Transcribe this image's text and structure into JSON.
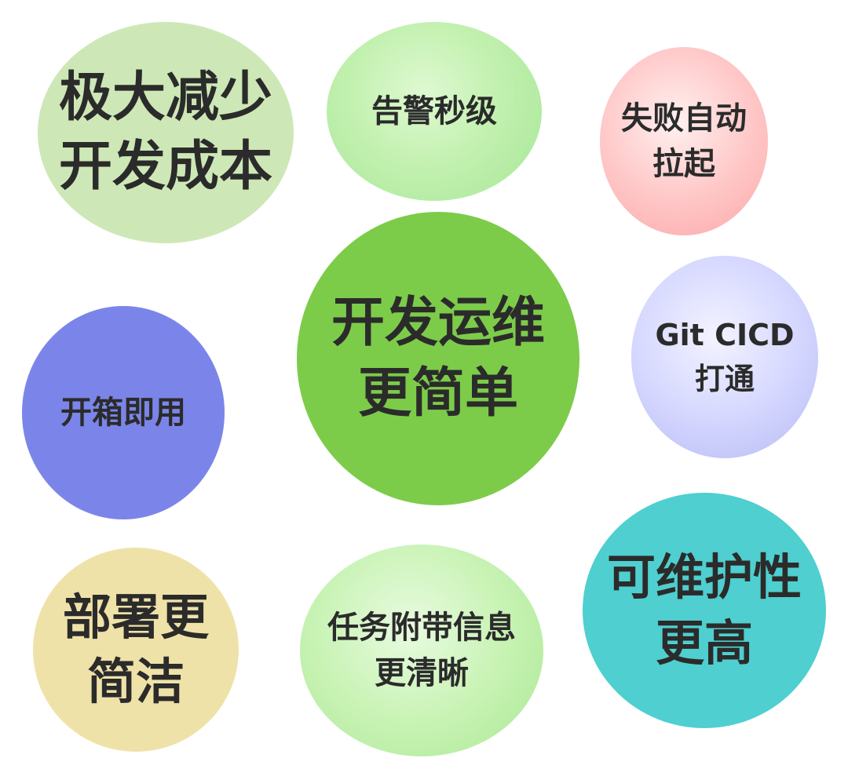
{
  "bubbles": {
    "cost": {
      "line1": "极大减少",
      "line2": "开发成本"
    },
    "alert": {
      "line1": "告警秒级"
    },
    "fail": {
      "line1": "失败自动",
      "line2": "拉起"
    },
    "center": {
      "line1": "开发运维",
      "line2": "更简单"
    },
    "box": {
      "line1": "开箱即用"
    },
    "git": {
      "line1": "Git CICD",
      "line2": "打通"
    },
    "maint": {
      "line1": "可维护性",
      "line2": "更高"
    },
    "deploy": {
      "line1": "部署更",
      "line2": "简洁"
    },
    "task": {
      "line1": "任务附带信息",
      "line2": "更清晰"
    }
  },
  "colors": {
    "cost": "#cde8b6",
    "alert": "#c3f1b0",
    "fail": "#ffc9c9",
    "center": "#7ccc4a",
    "box": "#7b85e9",
    "git": "#d6d8ff",
    "maint": "#4fcfcf",
    "deploy": "#efe2a8",
    "task": "#c9f3b5",
    "text": "#2b2b2b"
  }
}
